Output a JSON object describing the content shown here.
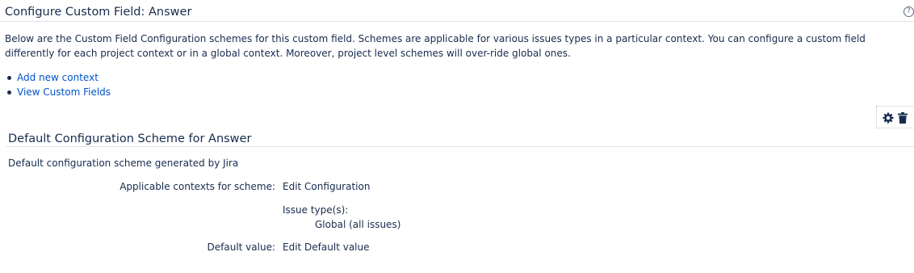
{
  "header": {
    "title": "Configure Custom Field: Answer",
    "help_icon": "?"
  },
  "intro_text": "Below are the Custom Field Configuration schemes for this custom field. Schemes are applicable for various issues types in a particular context. You can configure a custom field differently for each project context or in a global context. Moreover, project level schemes will over-ride global ones.",
  "links": [
    {
      "label": "Add new context"
    },
    {
      "label": "View Custom Fields"
    }
  ],
  "scheme": {
    "title": "Default Configuration Scheme for Answer",
    "description": "Default configuration scheme generated by Jira",
    "actions": {
      "configure_icon": "gear-icon",
      "delete_icon": "trash-icon"
    },
    "applicable_contexts_label": "Applicable contexts for scheme:",
    "edit_configuration_link": "Edit Configuration",
    "issue_types_label": "Issue type(s):",
    "issue_types_value": "Global (all issues)",
    "default_value_label": "Default value:",
    "edit_default_value_link": "Edit Default value"
  },
  "colors": {
    "link": "#0052cc",
    "text": "#172b4d",
    "divider": "#dfe1e6"
  }
}
